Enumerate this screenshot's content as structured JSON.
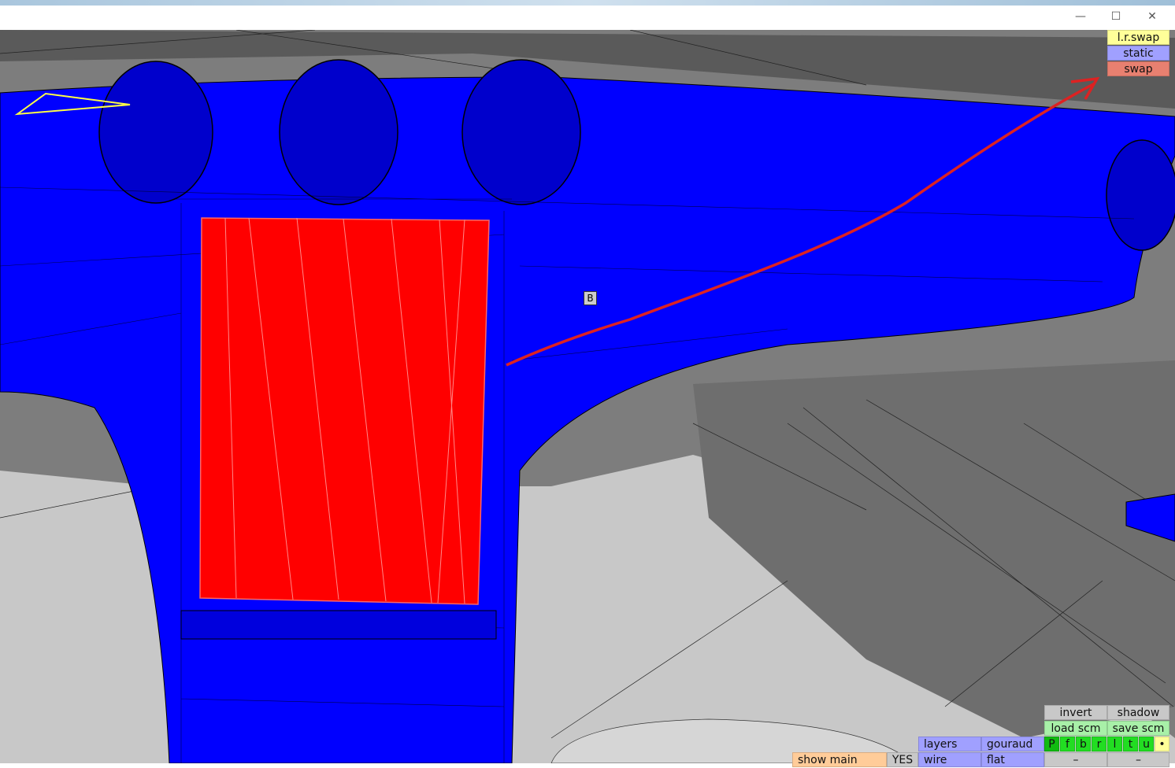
{
  "window": {
    "minimize_icon": "minimize-icon",
    "maximize_icon": "maximize-icon",
    "close_icon": "close-icon",
    "minimize": "—",
    "maximize": "☐",
    "close": "✕"
  },
  "viewport": {
    "marker_label": "B",
    "colors": {
      "mesh": "#0000ff",
      "screen": "#ff0000",
      "annotation": "#dd2222",
      "selection": "#ffff44"
    }
  },
  "top_buttons": {
    "lr_swap": "l.r.swap",
    "static": "static",
    "swap": "swap"
  },
  "bottom_panel": {
    "invert": "invert",
    "shadow": "shadow",
    "load_scm": "load scm",
    "save_scm": "save scm",
    "layers": "layers",
    "gouraud": "gouraud",
    "wire": "wire",
    "flat": "flat",
    "show_main": "show main",
    "yes": "YES",
    "views": [
      "P",
      "f",
      "b",
      "r",
      "l",
      "t",
      "u",
      "•"
    ],
    "minus1": "–",
    "minus2": "–"
  }
}
